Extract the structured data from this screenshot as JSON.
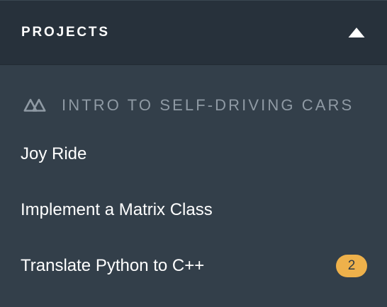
{
  "header": {
    "title": "PROJECTS",
    "toggle_icon": "triangle-up-icon"
  },
  "section": {
    "icon": "self-driving-car-logo-icon",
    "title": "INTRO TO SELF-DRIVING CARS"
  },
  "projects": [
    {
      "label": "Joy Ride"
    },
    {
      "label": "Implement a Matrix Class"
    },
    {
      "label": "Translate Python to C++",
      "badge": "2"
    }
  ],
  "colors": {
    "header_bg": "#27313b",
    "panel_bg": "#333f4a",
    "section_text": "#8f9aa4",
    "badge_bg": "#eeb14b"
  }
}
